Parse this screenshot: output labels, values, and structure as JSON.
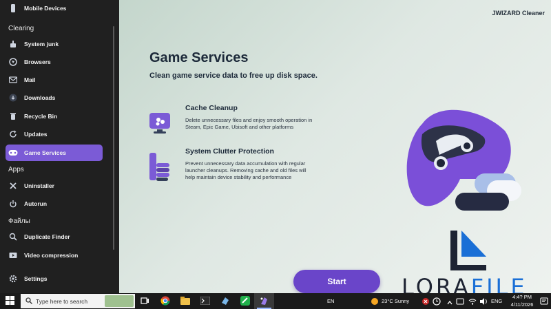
{
  "sidebar": {
    "top_item": "Mobile Devices",
    "sections": {
      "clearing": "Clearing",
      "apps": "Apps",
      "files": "Файлы"
    },
    "items": [
      {
        "label": "System junk",
        "icon": "broom-icon"
      },
      {
        "label": "Browsers",
        "icon": "globe-icon"
      },
      {
        "label": "Mail",
        "icon": "mail-icon"
      },
      {
        "label": "Downloads",
        "icon": "download-icon"
      },
      {
        "label": "Recycle Bin",
        "icon": "trash-icon"
      },
      {
        "label": "Updates",
        "icon": "refresh-icon"
      },
      {
        "label": "Game Services",
        "icon": "gamepad-icon",
        "active": true
      },
      {
        "label": "Uninstaller",
        "icon": "x-icon"
      },
      {
        "label": "Autorun",
        "icon": "power-icon"
      },
      {
        "label": "Duplicate Finder",
        "icon": "duplicate-icon"
      },
      {
        "label": "Video compression",
        "icon": "video-icon"
      },
      {
        "label": "Settings",
        "icon": "gear-icon"
      }
    ]
  },
  "header": {
    "brand": "JWIZARD Cleaner"
  },
  "main": {
    "title": "Game Services",
    "subtitle": "Clean game service data to free up disk space.",
    "features": [
      {
        "title": "Cache Cleanup",
        "description": "Delete unnecessary files and enjoy smooth operation in Steam, Epic Game, Ubisoft and other platforms"
      },
      {
        "title": "System Clutter Protection",
        "description": "Prevent unnecessary data accumulation with regular launcher cleanups. Removing cache and old files will help maintain device stability and performance"
      }
    ],
    "start_label": "Start"
  },
  "watermark": {
    "text_part1": "LORA",
    "text_part2": "FILE"
  },
  "taskbar": {
    "search_placeholder": "Type here to search",
    "lang_center": "EN",
    "weather": "23°C  Sunny",
    "lang": "ENG",
    "time": "4:4? PM",
    "date": "4/11/2026"
  },
  "colors": {
    "accent": "#7b5bd6",
    "start_button": "#6a45c9",
    "sidebar_bg": "#202020",
    "title": "#1d2a3a"
  }
}
